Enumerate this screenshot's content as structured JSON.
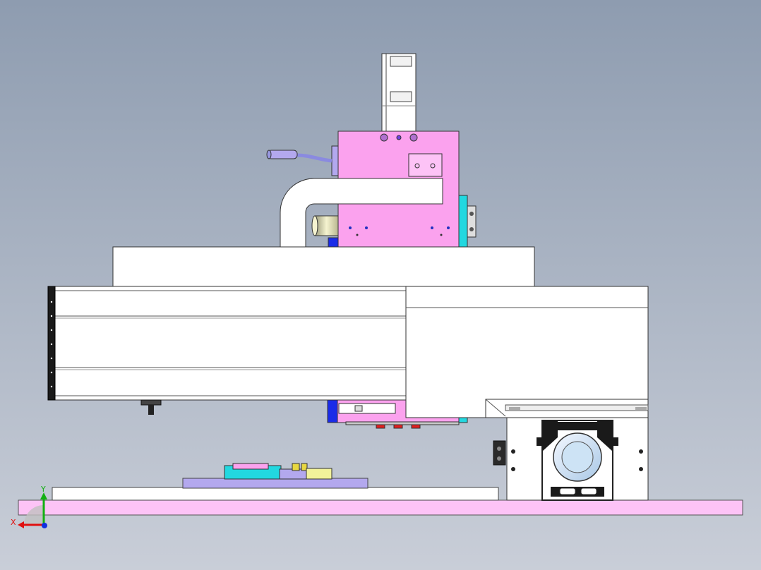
{
  "view": {
    "background_top": "#8e9cb0",
    "background_bottom": "#c9ced8"
  },
  "colors": {
    "pink": "#fba2ee",
    "light_pink": "#fdc3f6",
    "white_body": "#ffffff",
    "cyan": "#22d8e0",
    "blue": "#1a2be8",
    "lavender": "#b3a8ee",
    "yellow": "#f2f29a",
    "light_blue_motor": "#cde3f5",
    "outline": "#3a3a3a"
  },
  "triad": {
    "x_label": "X",
    "y_label": "Y",
    "x_color": "#e01010",
    "y_color": "#12b012",
    "z_color": "#1030e0"
  }
}
